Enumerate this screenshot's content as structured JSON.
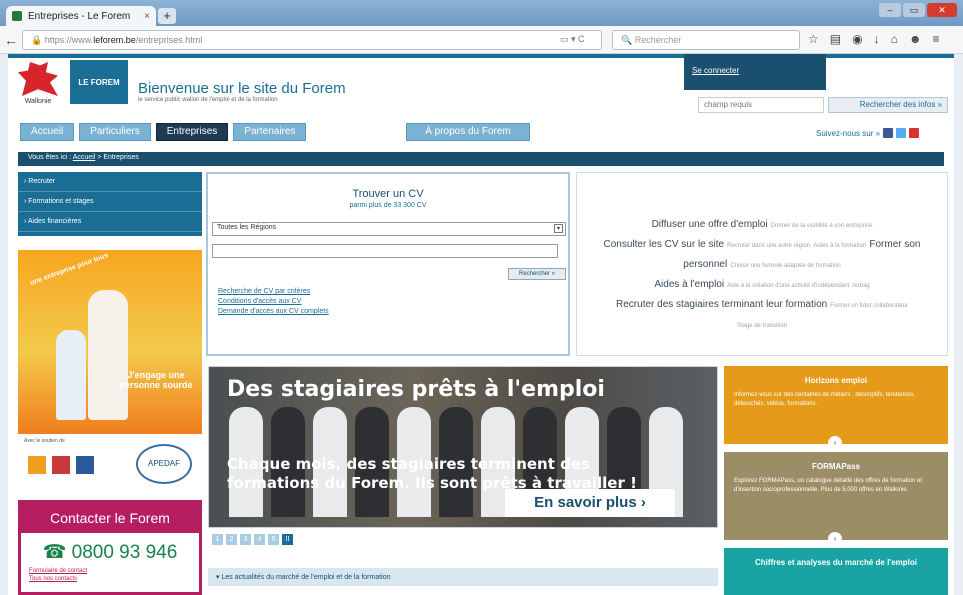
{
  "browser": {
    "tab_title": "Entreprises - Le Forem",
    "tab_close": "×",
    "new_tab": "+",
    "url_prefix": "https://www.",
    "url_domain": "leforem.be",
    "url_path": "/entreprises.html",
    "search_placeholder": "Rechercher",
    "url_icons": "▭ ▾  C"
  },
  "header": {
    "wallonie": "Wallonie",
    "forem_logo": "LE FOREM",
    "welcome": "Bienvenue sur le site du Forem",
    "tagline": "le service public wallon de l'emploi et de la formation",
    "connect": "Se connecter",
    "site_search_placeholder": "champ requis",
    "site_search_button": "Rechercher des infos »",
    "follow": "Suivez-nous sur »"
  },
  "nav": {
    "items": [
      "Accueil",
      "Particuliers",
      "Entreprises",
      "Partenaires"
    ],
    "about": "À propos du Forem"
  },
  "breadcrumb": {
    "prefix": "Vous êtes ici :",
    "home": "Accueil",
    "current": "> Entreprises"
  },
  "left_menu": {
    "items": [
      "› Recruter",
      "› Formations et stages",
      "› Aides financières"
    ]
  },
  "engage": {
    "stamp": "une entreprise pour tous",
    "slogan": "J'engage une personne sourde"
  },
  "partners": {
    "label": "Avec le soutien de",
    "apedaf": "APEDAF"
  },
  "contact": {
    "title": "Contacter le Forem",
    "phone": "0800 93 946",
    "link1": "Formulaire de contact",
    "link2": "Tous nos contacts"
  },
  "cv": {
    "title": "Trouver un CV",
    "subtitle": "parmi plus de 33 300 CV",
    "region": "Toutes les Régions",
    "button": "Rechercher »",
    "links": [
      "Recherche de CV par critères",
      "Conditions d'accès aux CV",
      "Demande d'accès aux CV complets"
    ]
  },
  "cloud": {
    "items": [
      {
        "text": "Diffuser une offre d'emploi",
        "size": "big"
      },
      {
        "text": "Donner de la visibilité à son entreprise",
        "size": "small"
      },
      {
        "text": "Consulter les CV sur le site",
        "size": "big"
      },
      {
        "text": "Recruter dans une autre région",
        "size": "small"
      },
      {
        "text": "Aides à la formation",
        "size": "small"
      },
      {
        "text": "Former son personnel",
        "size": "big"
      },
      {
        "text": "Choisir une formule adaptée de formation",
        "size": "small"
      },
      {
        "text": "Aides à l'emploi",
        "size": "big"
      },
      {
        "text": "Aide à la création d'une activité d'indépendant",
        "size": "small"
      },
      {
        "text": "Airbag",
        "size": "small"
      },
      {
        "text": "Recruter des stagiaires terminant leur formation",
        "size": "big"
      },
      {
        "text": "Former un futur collaborateur",
        "size": "small"
      },
      {
        "text": "Stage de transition",
        "size": "small"
      }
    ]
  },
  "banner": {
    "title": "Des stagiaires prêts à l'emploi",
    "text": "Chaque mois, des stagiaires terminent des formations du Forem. Ils sont prêts à travailler !",
    "button": "En savoir plus ›"
  },
  "pager": {
    "pages": [
      "1",
      "2",
      "3",
      "4",
      "5",
      "II"
    ]
  },
  "news": {
    "title": "▾ Les actualités du marché de l'emploi et de la formation"
  },
  "promos": [
    {
      "title": "Horizons emploi",
      "text": "Informez-vous sur des centaines de métiers : descriptifs, tendances, débouchés, vidéos, formations."
    },
    {
      "title": "FORMAPass",
      "text": "Explorez FORMAPass, un catalogue détaillé des offres de formation et d'insertion socioprofessionnelle. Plus de 5.000 offres en Wallonie."
    },
    {
      "title": "Chiffres et analyses du marché de l'emploi",
      "text": ""
    }
  ],
  "colors": {
    "primary": "#1a6e96",
    "dark_blue": "#1a4f70",
    "nav_light": "#7ab2d4",
    "contact": "#b51f62",
    "phone": "#17824a",
    "orange": "#e59a1a",
    "taupe": "#9c8d66",
    "teal": "#1aa3a3"
  }
}
